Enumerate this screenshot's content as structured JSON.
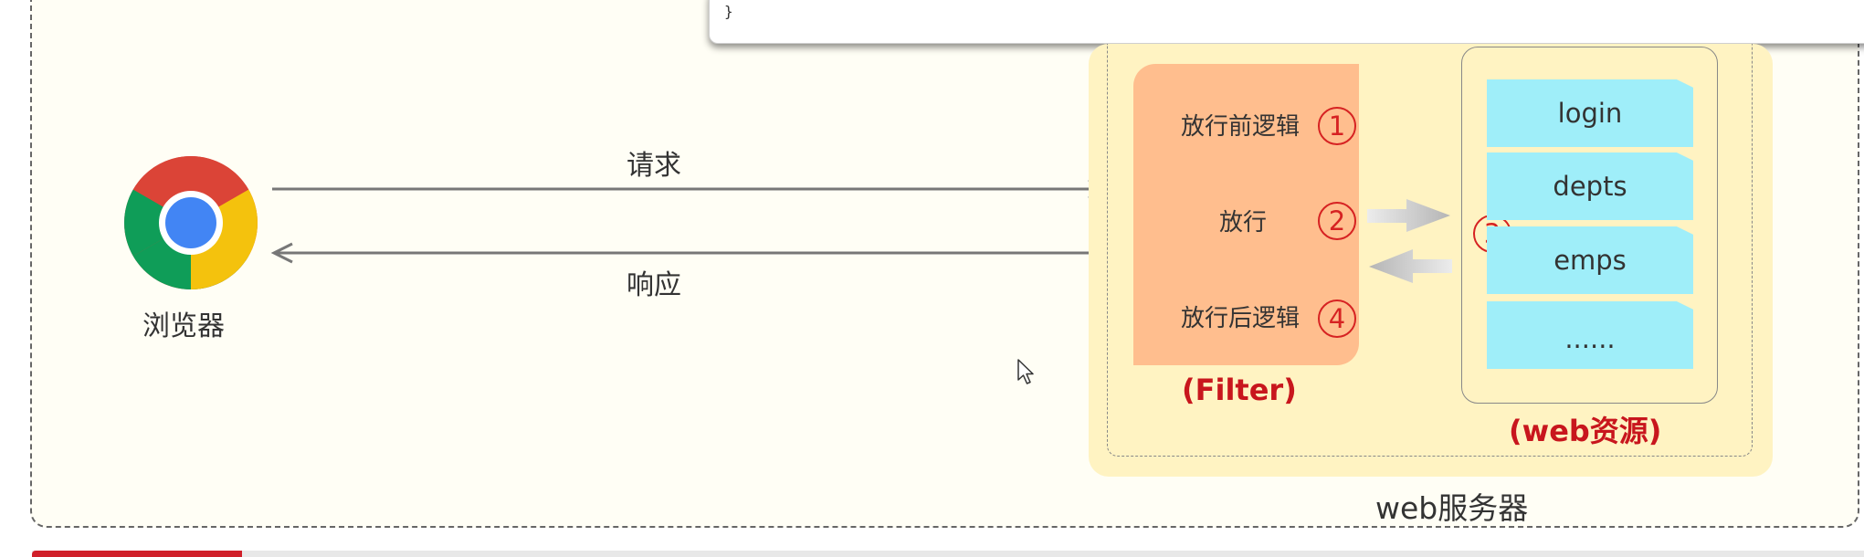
{
  "popup": {
    "code_tail": "}"
  },
  "browser": {
    "label": "浏览器"
  },
  "request_label": "请求",
  "response_label": "响应",
  "filter": {
    "step1": "放行前逻辑",
    "step2": "放行",
    "step4": "放行后逻辑",
    "label": "(Filter)"
  },
  "numbers": {
    "n1": "1",
    "n2": "2",
    "n3": "3",
    "n4": "4"
  },
  "resources": {
    "items": [
      "login",
      "depts",
      "emps",
      "......"
    ],
    "label": "(web资源)"
  },
  "server_label": "web服务器",
  "colors": {
    "filter_bg": "#ffbe8e",
    "resource_bg": "#9feef9",
    "server_bg": "#fff3c2",
    "accent_red": "#c8161d"
  }
}
